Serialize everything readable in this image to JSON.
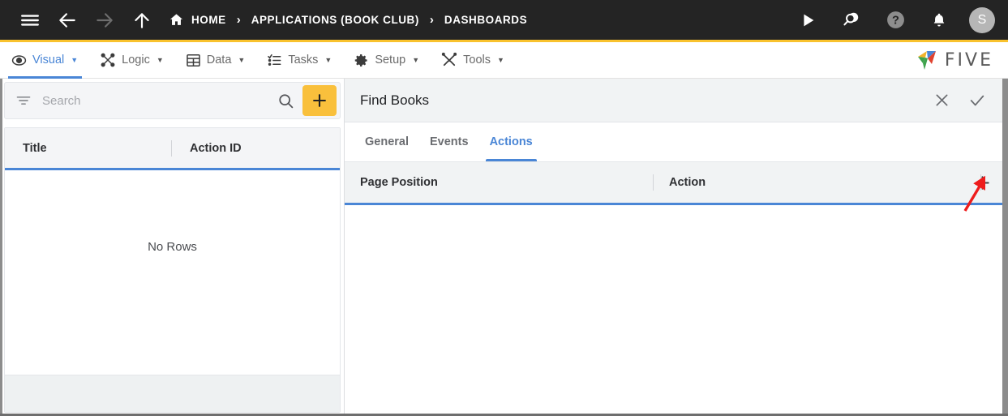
{
  "topbar": {
    "menu_icon": "hamburger-icon",
    "back_icon": "arrow-left-icon",
    "forward_icon": "arrow-right-icon",
    "up_icon": "arrow-up-icon",
    "breadcrumb": [
      {
        "label": "HOME",
        "icon": "home-icon"
      },
      {
        "label": "APPLICATIONS (BOOK CLUB)",
        "icon": ""
      },
      {
        "label": "DASHBOARDS",
        "icon": ""
      }
    ],
    "separator": "›",
    "right_icons": [
      "play-icon",
      "search-chat-icon",
      "help-icon",
      "bell-icon"
    ],
    "avatar_initial": "S",
    "accent_color": "#f9c22e",
    "bar_color": "#242424"
  },
  "menubar": {
    "items": [
      {
        "label": "Visual",
        "icon": "eye-icon",
        "caret": "▼",
        "active": true
      },
      {
        "label": "Logic",
        "icon": "logic-nodes-icon",
        "caret": "▼",
        "active": false
      },
      {
        "label": "Data",
        "icon": "table-grid-icon",
        "caret": "▼",
        "active": false
      },
      {
        "label": "Tasks",
        "icon": "checklist-icon",
        "caret": "▼",
        "active": false
      },
      {
        "label": "Setup",
        "icon": "gear-icon",
        "caret": "▼",
        "active": false
      },
      {
        "label": "Tools",
        "icon": "tools-icon",
        "caret": "▼",
        "active": false
      }
    ],
    "brand": "FIVE",
    "active_color": "#4a86d6"
  },
  "left_panel": {
    "search": {
      "placeholder": "Search",
      "value": "",
      "filter_icon": "filter-icon",
      "magnifier_icon": "search-icon"
    },
    "add_button": {
      "label": "+",
      "color": "#f9c03c"
    },
    "grid": {
      "columns": [
        "Title",
        "Action ID"
      ],
      "rows": [],
      "empty_text": "No Rows"
    }
  },
  "right_panel": {
    "title": "Find Books",
    "close_icon": "close-icon",
    "confirm_icon": "check-icon",
    "tabs": [
      {
        "label": "General",
        "active": false
      },
      {
        "label": "Events",
        "active": false
      },
      {
        "label": "Actions",
        "active": true
      }
    ],
    "grid": {
      "columns": [
        "Page Position",
        "Action"
      ],
      "rows": [],
      "add_icon": "plus-icon"
    }
  },
  "annotation": {
    "type": "arrow",
    "color": "#ee1c1c",
    "points_to": "add-action-row-button"
  }
}
